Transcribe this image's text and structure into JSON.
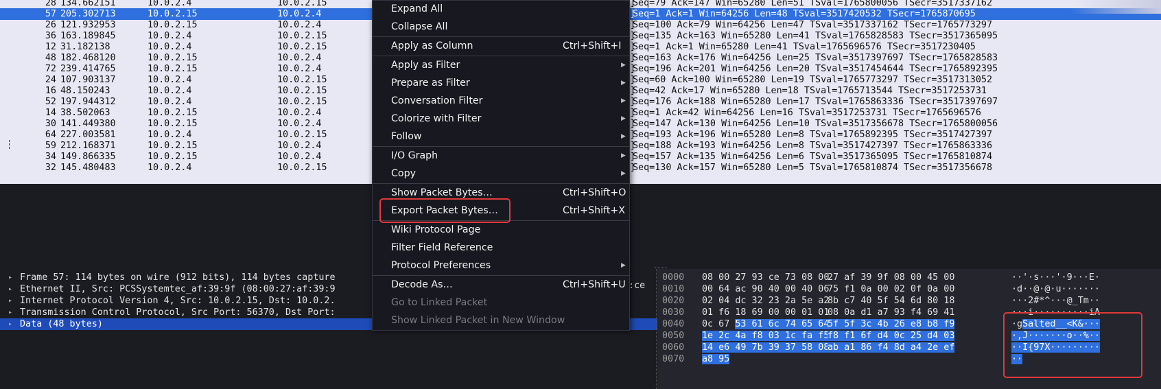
{
  "packets": [
    {
      "no": "28",
      "time": "134.662151",
      "src": "10.0.2.4",
      "dst": "10.0.2.15",
      "info": "Seq=79 Ack=147 Win=65280 Len=51 TSval=1765800056 TSecr=3517337162"
    },
    {
      "no": "57",
      "time": "205.302713",
      "src": "10.0.2.15",
      "dst": "10.0.2.4",
      "info": "Seq=1 Ack=1 Win=64256 Len=48 TSval=3517420532 TSecr=1765870695",
      "selected": true
    },
    {
      "no": "26",
      "time": "121.932953",
      "src": "10.0.2.15",
      "dst": "10.0.2.4",
      "info": "Seq=100 Ack=79 Win=64256 Len=47 TSval=3517337162 TSecr=1765773297"
    },
    {
      "no": "36",
      "time": "163.189845",
      "src": "10.0.2.4",
      "dst": "10.0.2.15",
      "info": "Seq=135 Ack=163 Win=65280 Len=41 TSval=1765828583 TSecr=3517365095"
    },
    {
      "no": "12",
      "time": "31.182138",
      "src": "10.0.2.4",
      "dst": "10.0.2.15",
      "info": "Seq=1 Ack=1 Win=65280 Len=41 TSval=1765696576 TSecr=3517230405"
    },
    {
      "no": "48",
      "time": "182.468120",
      "src": "10.0.2.15",
      "dst": "10.0.2.4",
      "info": "Seq=163 Ack=176 Win=64256 Len=25 TSval=3517397697 TSecr=1765828583"
    },
    {
      "no": "72",
      "time": "239.414765",
      "src": "10.0.2.15",
      "dst": "10.0.2.4",
      "info": "Seq=196 Ack=201 Win=64256 Len=20 TSval=3517454644 TSecr=1765892395"
    },
    {
      "no": "24",
      "time": "107.903137",
      "src": "10.0.2.4",
      "dst": "10.0.2.15",
      "info": "Seq=60 Ack=100 Win=65280 Len=19 TSval=1765773297 TSecr=3517313052"
    },
    {
      "no": "16",
      "time": "48.150243",
      "src": "10.0.2.4",
      "dst": "10.0.2.15",
      "info": "Seq=42 Ack=17 Win=65280 Len=18 TSval=1765713544 TSecr=3517253731"
    },
    {
      "no": "52",
      "time": "197.944312",
      "src": "10.0.2.4",
      "dst": "10.0.2.15",
      "info": "Seq=176 Ack=188 Win=65280 Len=17 TSval=1765863336 TSecr=3517397697"
    },
    {
      "no": "14",
      "time": "38.502063",
      "src": "10.0.2.15",
      "dst": "10.0.2.4",
      "info": "Seq=1 Ack=42 Win=64256 Len=16 TSval=3517253731 TSecr=1765696576"
    },
    {
      "no": "30",
      "time": "141.449380",
      "src": "10.0.2.15",
      "dst": "10.0.2.4",
      "info": "Seq=147 Ack=130 Win=64256 Len=10 TSval=3517356678 TSecr=1765800056"
    },
    {
      "no": "64",
      "time": "227.003581",
      "src": "10.0.2.4",
      "dst": "10.0.2.15",
      "info": "Seq=193 Ack=196 Win=65280 Len=8 TSval=1765892395 TSecr=3517427397"
    },
    {
      "no": "59",
      "time": "212.168371",
      "src": "10.0.2.15",
      "dst": "10.0.2.4",
      "info": "Seq=188 Ack=193 Win=64256 Len=8 TSval=3517427397 TSecr=1765863336",
      "marker": true
    },
    {
      "no": "34",
      "time": "149.866335",
      "src": "10.0.2.15",
      "dst": "10.0.2.4",
      "info": "Seq=157 Ack=135 Win=64256 Len=6 TSval=3517365095 TSecr=1765810874"
    },
    {
      "no": "32",
      "time": "145.480483",
      "src": "10.0.2.4",
      "dst": "10.0.2.15",
      "info": "Seq=130 Ack=157 Win=65280 Len=5 TSval=1765810874 TSecr=3517356678"
    }
  ],
  "bracket": "]",
  "details": [
    {
      "text": "Frame 57: 114 bytes on wire (912 bits), 114 bytes capture"
    },
    {
      "text": "Ethernet II, Src: PCSSystemtec_af:39:9f (08:00:27:af:39:9"
    },
    {
      "text": "Internet Protocol Version 4, Src: 10.0.2.15, Dst: 10.0.2."
    },
    {
      "text": "Transmission Control Protocol, Src Port: 56370, Dst Port:"
    },
    {
      "text": "Data (48 bytes)",
      "selected": true
    }
  ],
  "details_overflow": "3:ce",
  "bytes": [
    {
      "off": "0000",
      "hex1": "08 00 27 93 ce 73 08 00",
      "hex2": "27 af 39 9f 08 00 45 00",
      "ascii": "··'·s···'·9···E·"
    },
    {
      "off": "0010",
      "hex1": "00 64 ac 90 40 00 40 06",
      "hex2": "75 f1 0a 00 02 0f 0a 00",
      "ascii": "·d··@·@·u·······"
    },
    {
      "off": "0020",
      "hex1": "02 04 dc 32 23 2a 5e a2",
      "hex2": "8b c7 40 5f 54 6d 80 18",
      "ascii": "···2#*^···@_Tm··"
    },
    {
      "off": "0030",
      "hex1": "01 f6 18 69 00 00 01 01",
      "hex2": "08 0a d1 a7 93 f4 69 41",
      "ascii": "···i··········iA"
    },
    {
      "off": "0040",
      "hex1_pre": "0c 67 ",
      "hex1_hl": "53 61 6c 74 65 64",
      "hex2": "5f 5f 3c 4b 26 e8 b8 f9",
      "ascii_pre": "·g",
      "ascii_hl": "Salted__<K&···"
    },
    {
      "off": "0050",
      "hex1": "1e 2c 4a f8 03 1c fa f5",
      "hex2": "f8 f1 6f d4 0c 25 d4 03",
      "ascii": "·,J·······o··%··",
      "full": true
    },
    {
      "off": "0060",
      "hex1": "14 e6 49 7b 39 37 58 08",
      "hex2": "ab a1 86 f4 8d a4 2e ef",
      "ascii": "··I{97X·········",
      "full": true
    },
    {
      "off": "0070",
      "hex1": "a8 95",
      "hex2": "",
      "ascii": "··",
      "full": true
    }
  ],
  "menu": [
    {
      "label": "Expand All",
      "shortcut": "",
      "submenu": false
    },
    {
      "label": "Collapse All",
      "shortcut": "",
      "submenu": false
    },
    {
      "label": "Apply as Column",
      "shortcut": "Ctrl+Shift+I",
      "submenu": false
    },
    {
      "label": "Apply as Filter",
      "shortcut": "",
      "submenu": true
    },
    {
      "label": "Prepare as Filter",
      "shortcut": "",
      "submenu": true
    },
    {
      "label": "Conversation Filter",
      "shortcut": "",
      "submenu": true
    },
    {
      "label": "Colorize with Filter",
      "shortcut": "",
      "submenu": true
    },
    {
      "label": "Follow",
      "shortcut": "",
      "submenu": true
    },
    {
      "label": "I/O Graph",
      "shortcut": "",
      "submenu": true
    },
    {
      "label": "Copy",
      "shortcut": "",
      "submenu": true
    },
    {
      "label": "Show Packet Bytes…",
      "shortcut": "Ctrl+Shift+O",
      "submenu": false
    },
    {
      "label": "Export Packet Bytes…",
      "shortcut": "Ctrl+Shift+X",
      "submenu": false,
      "highlighted": true
    },
    {
      "label": "Wiki Protocol Page",
      "shortcut": "",
      "submenu": false
    },
    {
      "label": "Filter Field Reference",
      "shortcut": "",
      "submenu": false
    },
    {
      "label": "Protocol Preferences",
      "shortcut": "",
      "submenu": true
    },
    {
      "label": "Decode As…",
      "shortcut": "Ctrl+Shift+U",
      "submenu": false
    },
    {
      "label": "Go to Linked Packet",
      "shortcut": "",
      "submenu": false,
      "disabled": true
    },
    {
      "label": "Show Linked Packet in New Window",
      "shortcut": "",
      "submenu": false,
      "disabled": true
    }
  ],
  "colors": {
    "selection": "#2f6fde",
    "highlight_box": "#e03a3a",
    "list_bg": "#e8e8f5",
    "dark_bg": "#1b1c22"
  }
}
